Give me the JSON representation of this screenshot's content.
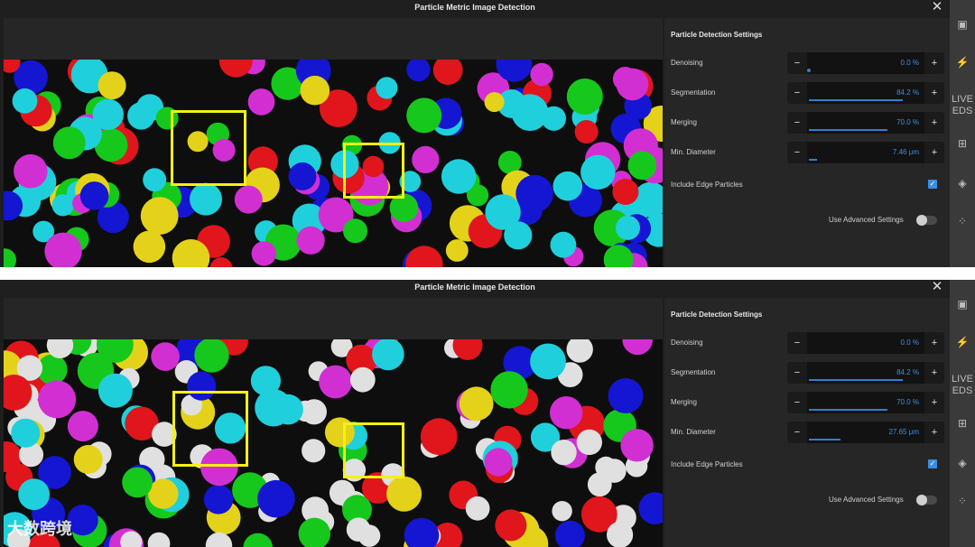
{
  "colors": {
    "accent": "#3b8ee0",
    "selection": "#f5f20e",
    "cyan": "#1fd0dc",
    "yellow": "#e4d21a",
    "magenta": "#d22fd2",
    "red": "#e0161c",
    "green": "#16c81c",
    "blue": "#1416d2",
    "white": "#e0e0e0"
  },
  "panels": [
    {
      "title": "Particle Metric Image Detection",
      "settings": {
        "header": "Particle Detection Settings",
        "denoising": {
          "label": "Denoising",
          "value": "0.0 %",
          "fraction": 0.0
        },
        "segmentation": {
          "label": "Segmentation",
          "value": "84.2 %",
          "fraction": 0.842
        },
        "merging": {
          "label": "Merging",
          "value": "70.0 %",
          "fraction": 0.7
        },
        "min_diameter": {
          "label": "Min. Diameter",
          "value": "7.46 μm",
          "fraction": 0.07
        },
        "edge": {
          "label": "Include Edge Particles",
          "checked": true
        },
        "advanced": {
          "label": "Use Advanced Settings",
          "on": false
        }
      }
    },
    {
      "title": "Particle Metric Image Detection",
      "settings": {
        "header": "Particle Detection Settings",
        "denoising": {
          "label": "Denoising",
          "value": "0.0 %",
          "fraction": 0.0
        },
        "segmentation": {
          "label": "Segmentation",
          "value": "84.2 %",
          "fraction": 0.842
        },
        "merging": {
          "label": "Merging",
          "value": "70.0 %",
          "fraction": 0.7
        },
        "min_diameter": {
          "label": "Min. Diameter",
          "value": "27.65 μm",
          "fraction": 0.28
        },
        "edge": {
          "label": "Include Edge Particles",
          "checked": true
        },
        "advanced": {
          "label": "Use Advanced Settings",
          "on": false
        }
      }
    }
  ],
  "stepper": {
    "minus": "−",
    "plus": "+"
  },
  "close_glyph": "✕",
  "checkmark": "✓",
  "strip": {
    "live_text": "LIVE",
    "eds_text": "EDS"
  },
  "watermark": "大数跨境"
}
